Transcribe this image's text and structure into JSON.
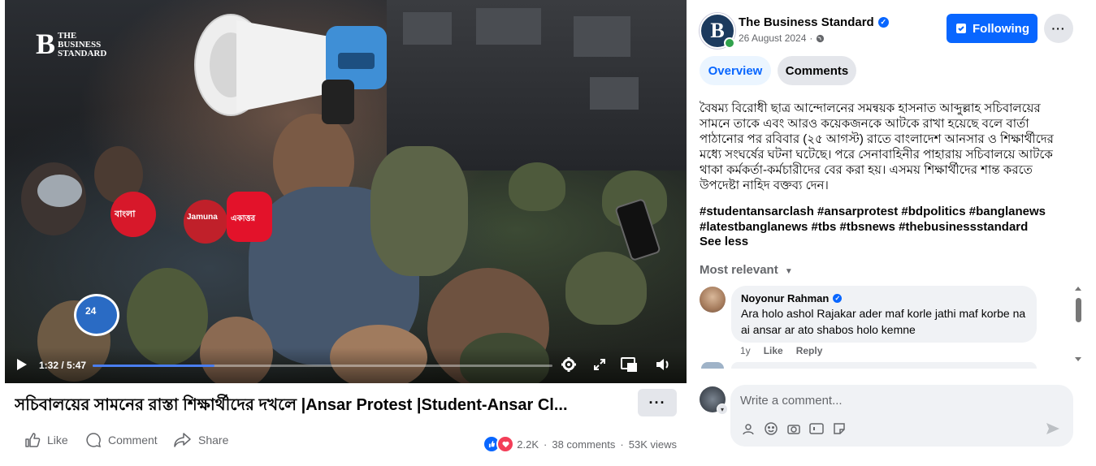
{
  "video": {
    "watermark_big": "B",
    "watermark_line1": "THE",
    "watermark_line2": "BUSINESS",
    "watermark_line3": "STANDARD",
    "time": "1:32 / 5:47",
    "progress": 0.265,
    "mic_labels": [
      "বাংলা",
      "Jamuna",
      "একাত্তর",
      "24"
    ]
  },
  "title": "সচিবালয়ের সামনের রাস্তা শিক্ষার্থীদের দখলে |Ansar Protest |Student-Ansar Cl...",
  "actions": {
    "like": "Like",
    "comment": "Comment",
    "share": "Share"
  },
  "stats": {
    "reactions": "2.2K",
    "comments": "38 comments",
    "views": "53K views",
    "sep": "·"
  },
  "page": {
    "name": "The Business Standard",
    "date": "26 August 2024",
    "avatar_letter": "B",
    "follow_label": "Following"
  },
  "tabs": {
    "overview": "Overview",
    "comments": "Comments"
  },
  "description": "বৈষম্য বিরোধী ছাত্র আন্দোলনের সমন্বয়ক হাসনাত আব্দুল্লাহ সচিবালয়ের সামনে তাকে এবং আরও কয়েকজনকে আটকে রাখা হয়েছে বলে বার্তা পাঠানোর পর রবিবার (২৫ আগস্ট) রাতে বাংলাদেশ আনসার ও শিক্ষার্থীদের মধ্যে সংঘর্ষের ঘটনা ঘটেছে। পরে সেনাবাহিনীর পাহারায় সচিবালয়ে আটকে থাকা কর্মকর্তা-কর্মচারীদের বের করা হয়। এসময় শিক্ষার্থীদের শান্ত করতে উপদেষ্টা নাহিদ বক্তব্য দেন।",
  "hashtags": "#studentansarclash #ansarprotest #bdpolitics #banglanews #latestbanglanews #tbs #tbsnews #thebusinessstandard",
  "see_less": "See less",
  "sort_label": "Most relevant",
  "comment": {
    "author": "Noyonur Rahman",
    "text": "Ara holo ashol Rajakar ader maf korle jathi maf korbe na ai ansar ar ato shabos holo kemne",
    "age": "1y",
    "like": "Like",
    "reply": "Reply"
  },
  "composer": {
    "placeholder": "Write a comment..."
  },
  "colors": {
    "accent": "#0866ff",
    "secondary_text": "#65676b",
    "bubble": "#f0f2f5"
  }
}
